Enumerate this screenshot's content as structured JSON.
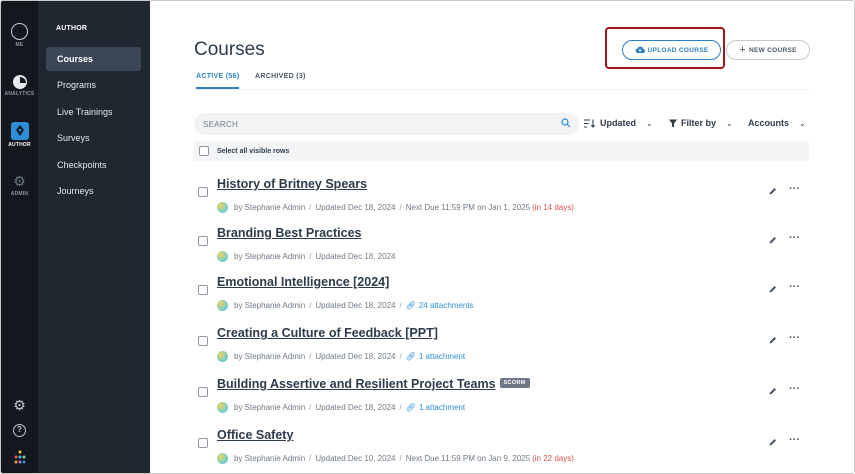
{
  "rail": {
    "items": [
      {
        "label": "ME"
      },
      {
        "label": "ANALYTICS"
      },
      {
        "label": "AUTHOR"
      },
      {
        "label": "ADMIN"
      }
    ]
  },
  "nav": {
    "header": "AUTHOR",
    "items": [
      {
        "label": "Courses",
        "active": true
      },
      {
        "label": "Programs"
      },
      {
        "label": "Live Trainings"
      },
      {
        "label": "Surveys"
      },
      {
        "label": "Checkpoints"
      },
      {
        "label": "Journeys"
      }
    ]
  },
  "page": {
    "title": "Courses",
    "tabs": [
      {
        "label": "ACTIVE (56)",
        "active": true
      },
      {
        "label": "ARCHIVED (3)"
      }
    ],
    "upload_label": "UPLOAD COURSE",
    "new_label": "NEW COURSE"
  },
  "toolbar": {
    "search_placeholder": "SEARCH",
    "sort_label": "Updated",
    "filter_label": "Filter by",
    "accounts_label": "Accounts",
    "select_all_label": "Select all visible rows"
  },
  "courses": [
    {
      "title": "History of Britney Spears",
      "author": "by Stephanie Admin",
      "updated": "Updated Dec 18, 2024",
      "due": "Next Due 11:59 PM on Jan 1, 2025",
      "due_in": "(in 14 days)"
    },
    {
      "title": "Branding Best Practices",
      "author": "by Stephanie Admin",
      "updated": "Updated Dec 18, 2024"
    },
    {
      "title": "Emotional Intelligence [2024]",
      "author": "by Stephanie Admin",
      "updated": "Updated Dec 18, 2024",
      "attachments": "24 attachments"
    },
    {
      "title": "Creating a Culture of Feedback [PPT]",
      "author": "by Stephanie Admin",
      "updated": "Updated Dec 18, 2024",
      "attachments": "1 attachment"
    },
    {
      "title": "Building Assertive and Resilient Project Teams",
      "badge": "SCORM",
      "author": "by Stephanie Admin",
      "updated": "Updated Dec 18, 2024",
      "attachments": "1 attachment"
    },
    {
      "title": "Office Safety",
      "author": "by Stephanie Admin",
      "updated": "Updated Dec 10, 2024",
      "due": "Next Due 11:59 PM on Jan 9, 2025",
      "due_in": "(in 22 days)"
    }
  ],
  "colors": {
    "accent": "#2c7fc2",
    "highlight": "#a3151c",
    "due_soon": "#d9534f",
    "rail_bg": "#14181e",
    "nav_bg": "#1f2731"
  }
}
